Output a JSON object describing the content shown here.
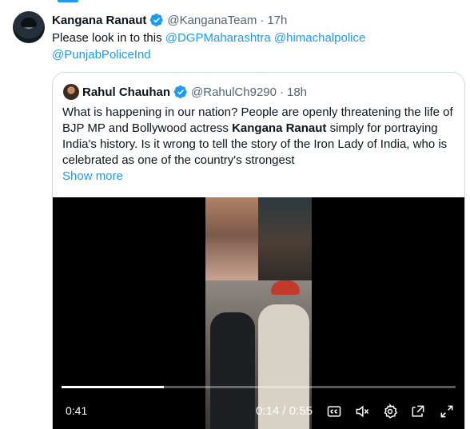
{
  "tweet": {
    "author_name": "Kangana Ranaut",
    "author_handle": "@KanganaTeam",
    "separator": "·",
    "time_ago": "17h",
    "text_prefix": "Please look in to this ",
    "mentions": [
      "@DGPMaharashtra",
      "@himachalpolice",
      "@PunjabPoliceInd"
    ]
  },
  "quote": {
    "author_name": "Rahul Chauhan",
    "author_handle": "@RahulCh9290",
    "separator": "·",
    "time_ago": "18h",
    "text_before": "What is happening in our nation? People are openly threatening the life of BJP MP and Bollywood actress ",
    "text_bold": "Kangana Ranaut",
    "text_after": " simply for portraying India's history. Is it wrong to tell the story of the Iron Lady of India, who is celebrated as one of the country's strongest",
    "show_more": "Show more"
  },
  "video": {
    "elapsed_left": "0:41",
    "current_time": "0:14",
    "time_separator": "/",
    "duration": "0:55",
    "progress_fraction": 0.26,
    "controls": [
      "captions-icon",
      "mute-icon",
      "settings-icon",
      "popout-icon",
      "fullscreen-icon"
    ]
  },
  "colors": {
    "accent": "#1d9bf0",
    "text": "#0f1419",
    "muted": "#536471",
    "border": "#cfd9de"
  }
}
